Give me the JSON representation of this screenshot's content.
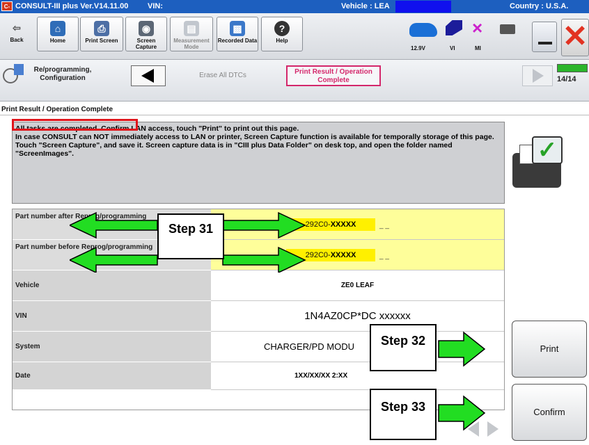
{
  "titlebar": {
    "app": "CONSULT-III plus  Ver.V14.11.00",
    "vin_label": "VIN:",
    "vehicle_label": "Vehicle : LEA",
    "country": "Country : U.S.A.",
    "logo_text": "C-III"
  },
  "toolbar": {
    "back": "Back",
    "home": "Home",
    "print_screen": "Print Screen",
    "screen_capture": "Screen Capture",
    "measurement_mode": "Measurement Mode",
    "recorded_data": "Recorded Data",
    "help": "Help",
    "voltage": "12.9V",
    "vi": "VI",
    "mi": "MI"
  },
  "nav": {
    "reprog_label": "Re/programming, Configuration",
    "erase_all": "Erase All DTCs",
    "print_result": "Print Result / Operation Complete",
    "step_count": "14/14"
  },
  "page_title": "Print Result / Operation Complete",
  "message": {
    "line1": "All tasks are completed. Confirm LAN access, touch \"Print\" to print out this page.",
    "line2": "In case CONSULT can NOT immediately access to LAN or printer, Screen Capture function is available for temporally storage of this page. Touch \"Screen Capture\", and save it. Screen capture data is in \"CIII plus Data Folder\" on desk top, and open the folder named \"ScreenImages\"."
  },
  "table": {
    "part_after_label": "Part number after Reprog/programming",
    "part_after_prefix": "292C0-",
    "part_after_suffix": "XXXXX",
    "part_after_dash": "_ _",
    "part_before_label": "Part number before Reprog/programming",
    "part_before_prefix": "292C0-",
    "part_before_suffix": "XXXXX",
    "part_before_dash": "_ _",
    "vehicle_label": "Vehicle",
    "vehicle_value": "ZE0 LEAF",
    "vin_label": "VIN",
    "vin_value": "1N4AZ0CP*DC xxxxxx",
    "system_label": "System",
    "system_value": "CHARGER/PD MODU",
    "date_label": "Date",
    "date_value": "1XX/XX/XX 2:XX"
  },
  "callouts": {
    "step31": "Step 31",
    "step32": "Step 32",
    "step33": "Step 33"
  },
  "buttons": {
    "print": "Print",
    "confirm": "Confirm"
  },
  "colors": {
    "titlebar": "#1d5fbf",
    "highlight_yellow": "#fefe9a",
    "part_number_yellow": "#fff000",
    "arrow_green": "#22dd22",
    "accent_pink": "#d4276b",
    "red_box": "#e0161c"
  }
}
